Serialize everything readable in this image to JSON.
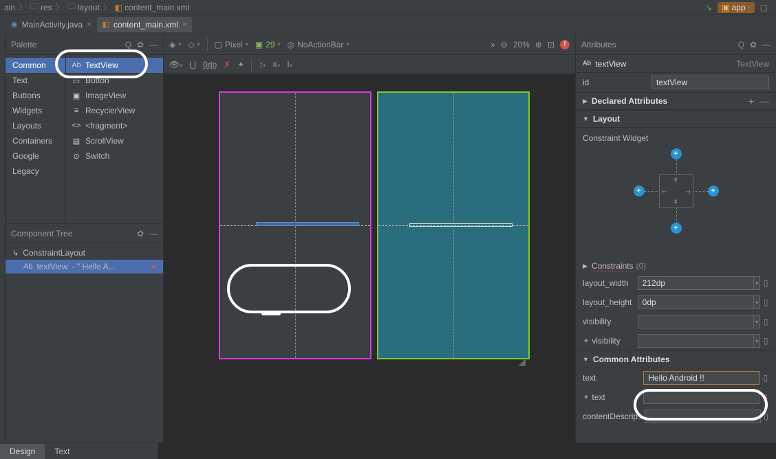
{
  "breadcrumb": {
    "items": [
      "ain",
      "res",
      "layout",
      "content_main.xml"
    ]
  },
  "run_config": "app",
  "tabs": [
    {
      "name": "MainActivity.java",
      "active": false
    },
    {
      "name": "content_main.xml",
      "active": true
    }
  ],
  "palette": {
    "title": "Palette",
    "cats": [
      "Common",
      "Text",
      "Buttons",
      "Widgets",
      "Layouts",
      "Containers",
      "Google",
      "Legacy"
    ],
    "selected_cat": "Common",
    "items": [
      {
        "icon": "Ab",
        "label": "TextView",
        "selected": true
      },
      {
        "icon": "▭",
        "label": "Button"
      },
      {
        "icon": "▣",
        "label": "ImageView"
      },
      {
        "icon": "≡",
        "label": "RecyclerView"
      },
      {
        "icon": "<>",
        "label": "<fragment>"
      },
      {
        "icon": "▤",
        "label": "ScrollView"
      },
      {
        "icon": "⊙",
        "label": "Switch"
      }
    ]
  },
  "component_tree": {
    "title": "Component Tree",
    "root": "ConstraintLayout",
    "child": {
      "id": "textView",
      "preview": "- \" Hello A..."
    }
  },
  "design_toolbar": {
    "device": "Pixel",
    "api": "29",
    "theme": "NoActionBar",
    "zoom": "20%",
    "margin": "0dp"
  },
  "attributes": {
    "title": "Attributes",
    "widget_type": "textView",
    "widget_class": "TextView",
    "id": "textView",
    "sections": {
      "declared": "Declared Attributes",
      "layout": "Layout",
      "constraint_widget": "Constraint Widget",
      "constraints": "Constraints",
      "constraints_count": "(0)",
      "common": "Common Attributes"
    },
    "layout_width": "212dp",
    "layout_height": "0dp",
    "visibility": "",
    "tools_visibility": "",
    "text": "Hello Android !!",
    "tools_text": "",
    "contentDescription_label": "contentDescrip..."
  },
  "bottom_tabs": [
    "Design",
    "Text"
  ]
}
